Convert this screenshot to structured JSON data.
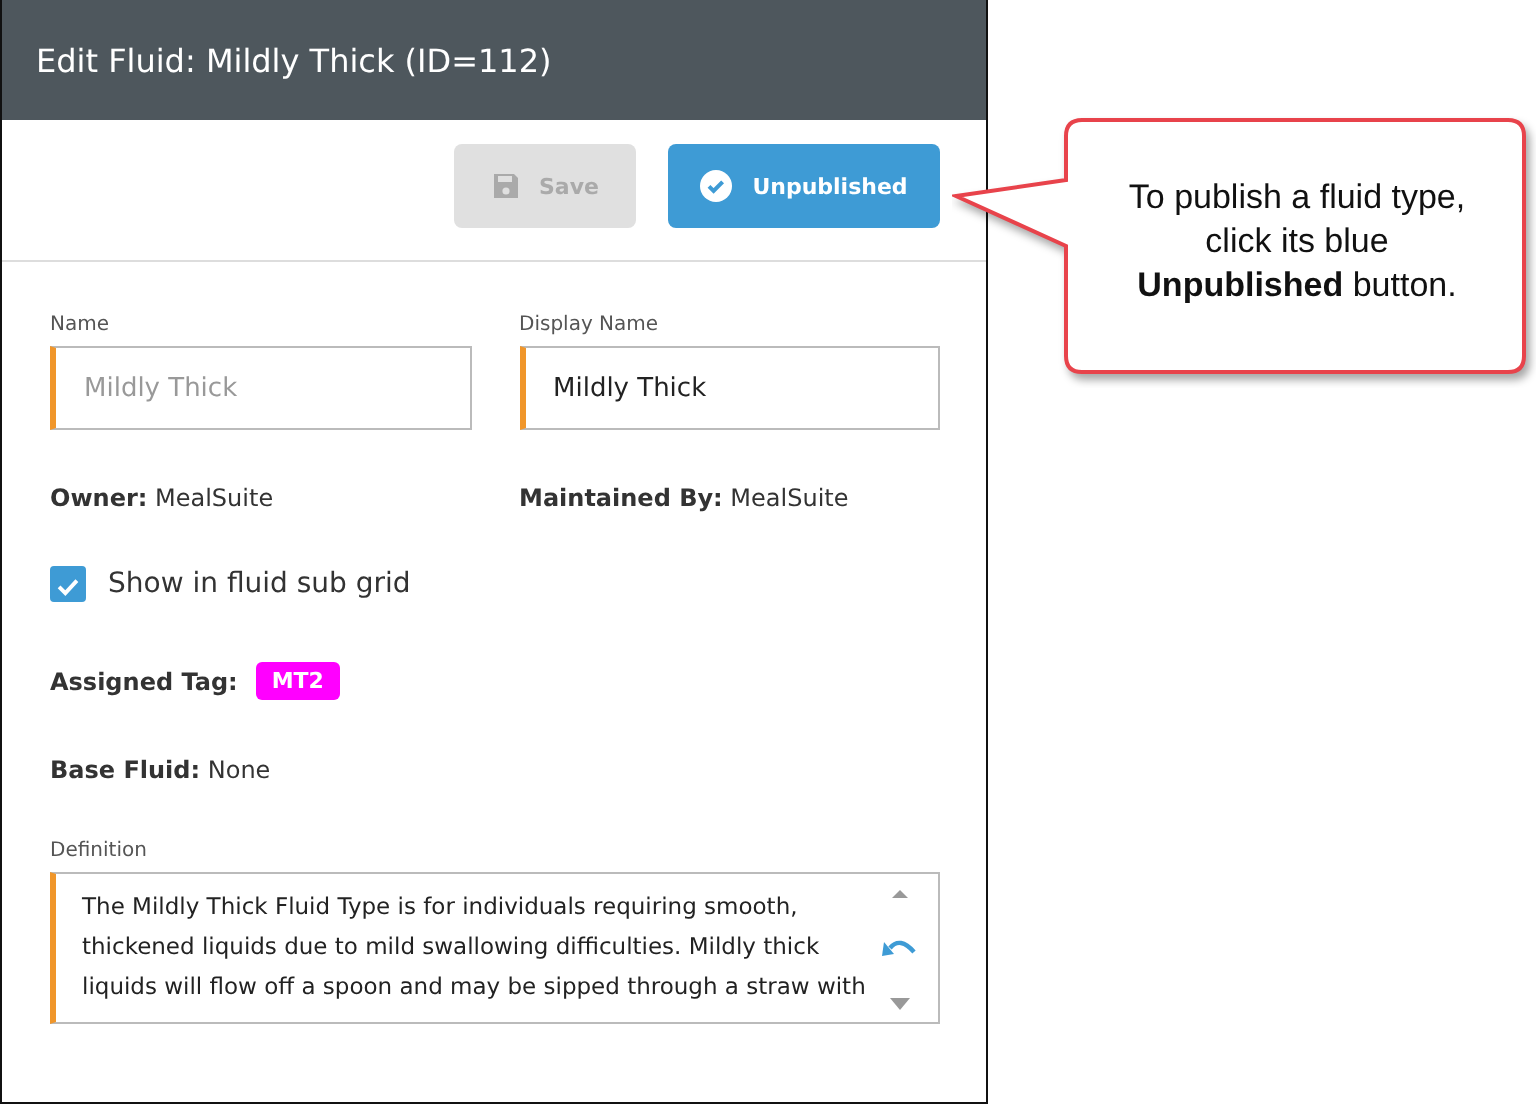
{
  "window": {
    "title": "Edit Fluid: Mildly Thick (ID=112)"
  },
  "toolbar": {
    "save_button": {
      "label": "Save",
      "disabled": true
    },
    "publish_button": {
      "label": "Unpublished"
    }
  },
  "fields": [
    {
      "label": "Name",
      "value": "Mildly Thick",
      "disabled": true
    },
    {
      "label": "Display Name",
      "value": "Mildly Thick",
      "disabled": false
    }
  ],
  "owner": {
    "label": "Owner:",
    "value": "MealSuite"
  },
  "maintained_by": {
    "label": "Maintained By:",
    "value": "MealSuite"
  },
  "show_in_sub_grid": {
    "label": "Show in fluid sub grid",
    "checked": true
  },
  "assigned_tag": {
    "label": "Assigned Tag:",
    "tag": "MT2",
    "color": "#ff00ff"
  },
  "base_fluid": {
    "label": "Base Fluid:",
    "value": "None"
  },
  "definition": {
    "label": "Definition",
    "value": "The Mildly Thick Fluid Type is for individuals requiring smooth, thickened liquids due to mild swallowing difficulties. Mildly thick liquids will flow off a spoon and may be sipped through a straw with"
  },
  "callout": {
    "text": "To publish a fluid type, click its blue **Unpublished** button."
  }
}
